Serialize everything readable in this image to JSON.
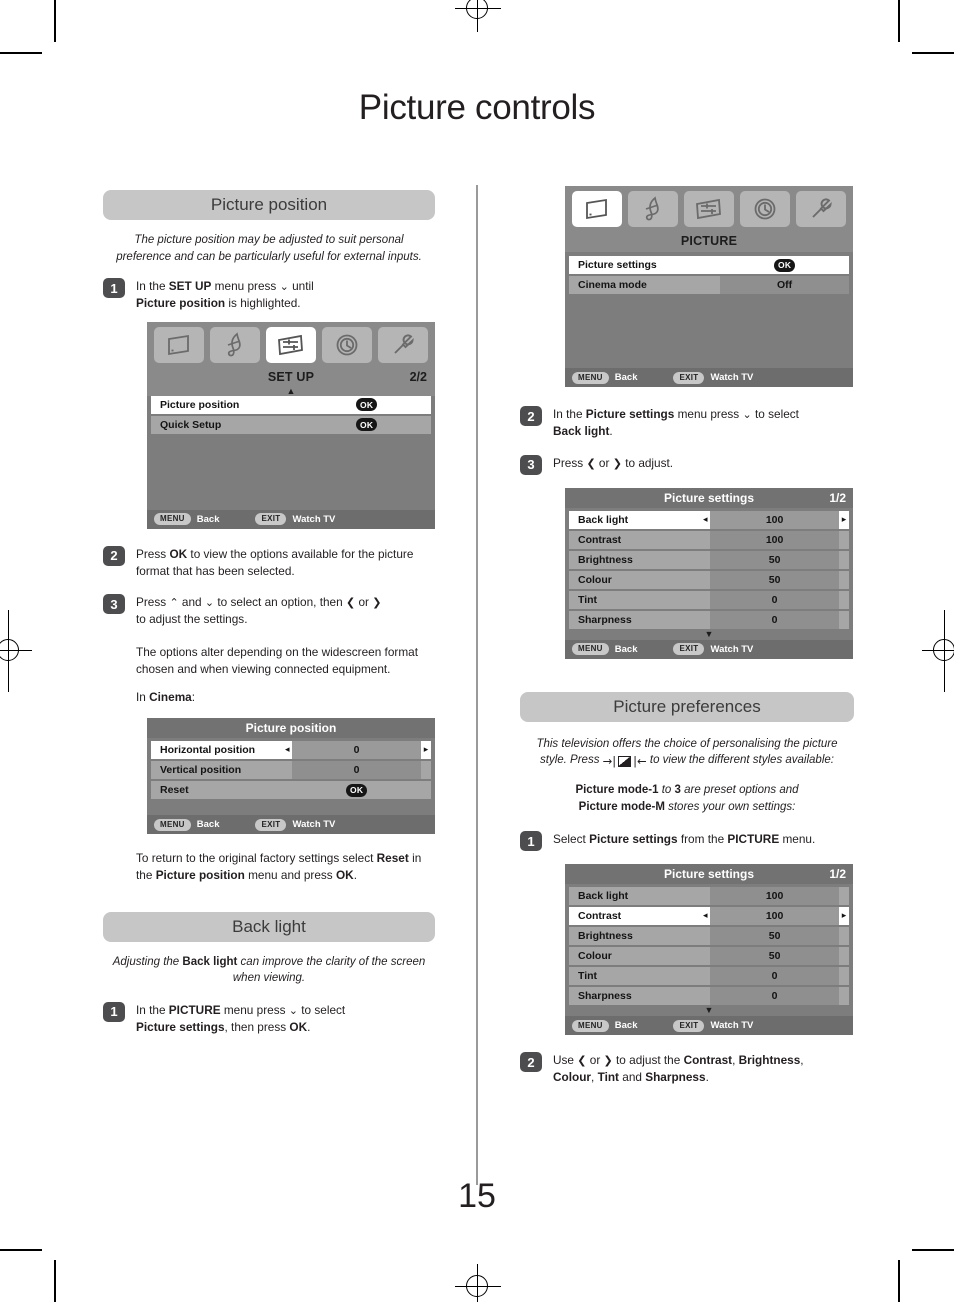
{
  "document": {
    "page_title": "Picture controls",
    "page_number": "15"
  },
  "left_column": {
    "section1": {
      "heading": "Picture position",
      "intro": "The picture position may be adjusted to suit personal preference and can be particularly useful for external inputs.",
      "step1_num": "1",
      "step1_text_a": "In the ",
      "step1_bold_a": "SET UP",
      "step1_text_b": " menu press ",
      "step1_arrow": "⌄",
      "step1_text_c": " until ",
      "step1_bold_b": "Picture position",
      "step1_text_d": " is highlighted.",
      "step2_num": "2",
      "step2_text_a": "Press ",
      "step2_bold_a": "OK",
      "step2_text_b": " to view the options available for the picture format that has been selected.",
      "step3_num": "3",
      "step3_text_a": "Press ",
      "step3_up": "⌃",
      "step3_text_b": " and ",
      "step3_down": "⌄",
      "step3_text_c": " to select an option, then ",
      "step3_left": "❮",
      "step3_text_d": " or ",
      "step3_right": "❯",
      "step3_text_e": " to adjust the settings.",
      "note1": "The options alter depending on the widescreen format chosen and when viewing connected equipment.",
      "note2_a": "In ",
      "note2_bold": "Cinema",
      "note2_b": ":",
      "reset_note_a": "To return to the original factory settings select ",
      "reset_note_bold_a": "Reset",
      "reset_note_b": " in the ",
      "reset_note_bold_b": "Picture position",
      "reset_note_c": " menu and press ",
      "reset_note_bold_c": "OK",
      "reset_note_d": "."
    },
    "setup_osd": {
      "title": "SET UP",
      "page_indicator": "2/2",
      "icons": [
        "picture-icon",
        "sound-icon",
        "setup-icon",
        "clock-icon",
        "tools-icon"
      ],
      "active_icon_index": 2,
      "rows": [
        {
          "label": "Picture position",
          "value": "OK",
          "type": "ok",
          "selected": true
        },
        {
          "label": "Quick Setup",
          "value": "OK",
          "type": "ok",
          "selected": false
        }
      ],
      "footer": {
        "menu_key": "MENU",
        "menu_label": "Back",
        "exit_key": "EXIT",
        "exit_label": "Watch TV"
      }
    },
    "picture_position_osd": {
      "title": "Picture position",
      "rows": [
        {
          "label": "Horizontal position",
          "value": "0",
          "type": "adjust",
          "selected": true
        },
        {
          "label": "Vertical position",
          "value": "0",
          "type": "value",
          "selected": false
        },
        {
          "label": "Reset",
          "value": "OK",
          "type": "ok",
          "selected": false
        }
      ],
      "footer": {
        "menu_key": "MENU",
        "menu_label": "Back",
        "exit_key": "EXIT",
        "exit_label": "Watch TV"
      }
    },
    "section2": {
      "heading": "Back light",
      "intro_a": "Adjusting the ",
      "intro_bold": "Back light",
      "intro_b": " can improve the clarity of the screen when viewing.",
      "step1_num": "1",
      "step1_text_a": "In the ",
      "step1_bold_a": "PICTURE",
      "step1_text_b": " menu press ",
      "step1_arrow": "⌄",
      "step1_text_c": " to select ",
      "step1_bold_b": "Picture settings",
      "step1_text_d": ", then press ",
      "step1_bold_c": "OK",
      "step1_text_e": "."
    }
  },
  "right_column": {
    "picture_osd": {
      "title": "PICTURE",
      "icons": [
        "picture-icon",
        "sound-icon",
        "setup-icon",
        "clock-icon",
        "tools-icon"
      ],
      "active_icon_index": 0,
      "rows": [
        {
          "label": "Picture settings",
          "value": "OK",
          "type": "ok",
          "selected": true
        },
        {
          "label": "Cinema mode",
          "value": "Off",
          "type": "value",
          "selected": false
        }
      ],
      "footer": {
        "menu_key": "MENU",
        "menu_label": "Back",
        "exit_key": "EXIT",
        "exit_label": "Watch TV"
      }
    },
    "backlight_steps": {
      "step2_num": "2",
      "step2_text_a": "In the ",
      "step2_bold_a": "Picture settings",
      "step2_text_b": " menu press ",
      "step2_arrow": "⌄",
      "step2_text_c": " to select ",
      "step2_bold_b": "Back light",
      "step2_text_d": ".",
      "step3_num": "3",
      "step3_text_a": "Press ",
      "step3_left": "❮",
      "step3_text_b": " or ",
      "step3_right": "❯",
      "step3_text_c": " to adjust."
    },
    "picture_settings_osd_1": {
      "title": "Picture settings",
      "page_indicator": "1/2",
      "rows": [
        {
          "label": "Back light",
          "value": "100",
          "type": "adjust",
          "selected": true
        },
        {
          "label": "Contrast",
          "value": "100",
          "type": "value",
          "selected": false
        },
        {
          "label": "Brightness",
          "value": "50",
          "type": "value",
          "selected": false
        },
        {
          "label": "Colour",
          "value": "50",
          "type": "value",
          "selected": false
        },
        {
          "label": "Tint",
          "value": "0",
          "type": "value",
          "selected": false
        },
        {
          "label": "Sharpness",
          "value": "0",
          "type": "value",
          "selected": false
        }
      ],
      "footer": {
        "menu_key": "MENU",
        "menu_label": "Back",
        "exit_key": "EXIT",
        "exit_label": "Watch TV"
      }
    },
    "section3": {
      "heading": "Picture preferences",
      "intro_a": "This television offers the choice of personalising the picture style. Press ",
      "intro_b": " to view the different styles available:",
      "modes_bold_a": "Picture mode-1",
      "modes_text_a": " to ",
      "modes_bold_b": "3",
      "modes_text_b": " are preset options and",
      "modes_bold_c": "Picture mode-M",
      "modes_text_c": " stores your own settings:",
      "step1_num": "1",
      "step1_text_a": "Select ",
      "step1_bold_a": "Picture settings",
      "step1_text_b": " from the ",
      "step1_bold_b": "PICTURE",
      "step1_text_c": " menu.",
      "step2_num": "2",
      "step2_text_a": "Use ",
      "step2_left": "❮",
      "step2_text_b": " or ",
      "step2_right": "❯",
      "step2_text_c": " to adjust the ",
      "step2_bold_a": "Contrast",
      "step2_text_d": ", ",
      "step2_bold_b": "Brightness",
      "step2_text_e": ", ",
      "step2_bold_c": "Colour",
      "step2_text_f": ", ",
      "step2_bold_d": "Tint",
      "step2_text_g": " and ",
      "step2_bold_e": "Sharpness",
      "step2_text_h": "."
    },
    "picture_settings_osd_2": {
      "title": "Picture settings",
      "page_indicator": "1/2",
      "rows": [
        {
          "label": "Back light",
          "value": "100",
          "type": "value",
          "selected": false
        },
        {
          "label": "Contrast",
          "value": "100",
          "type": "adjust",
          "selected": true
        },
        {
          "label": "Brightness",
          "value": "50",
          "type": "value",
          "selected": false
        },
        {
          "label": "Colour",
          "value": "50",
          "type": "value",
          "selected": false
        },
        {
          "label": "Tint",
          "value": "0",
          "type": "value",
          "selected": false
        },
        {
          "label": "Sharpness",
          "value": "0",
          "type": "value",
          "selected": false
        }
      ],
      "footer": {
        "menu_key": "MENU",
        "menu_label": "Back",
        "exit_key": "EXIT",
        "exit_label": "Watch TV"
      }
    }
  },
  "colors": {
    "section_bar": "#c6c6c6",
    "step_badge": "#4d4d4f",
    "osd_bg": "#7d7d7d",
    "osd_header": "#8a8a8a",
    "osd_row": "#a6a6a6",
    "osd_row_selected": "#ffffff",
    "osd_footer": "#6d6d6d",
    "text": "#231f20"
  }
}
